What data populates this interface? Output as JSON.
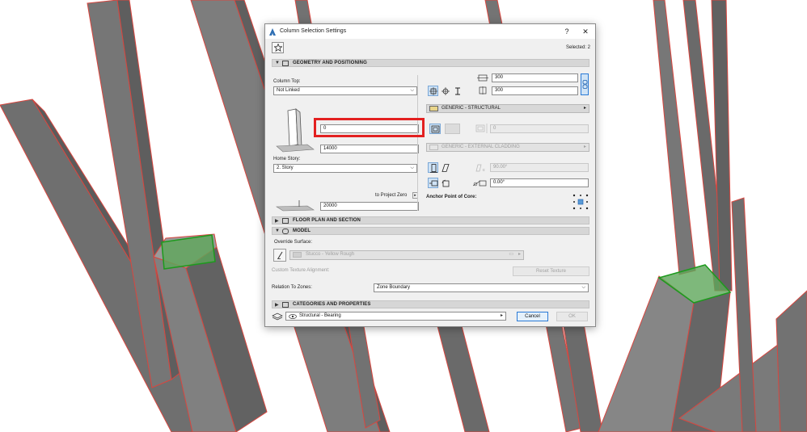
{
  "dialog": {
    "title": "Column Selection Settings",
    "help_label": "?",
    "close_label": "✕",
    "selected_text": "Selected: 2",
    "accent_color": "#e32020"
  },
  "geometry": {
    "section_title": "GEOMETRY AND POSITIONING",
    "column_top_label": "Column Top:",
    "column_top_value": "Not Linked",
    "top_offset_value": "0",
    "height_value": "14000",
    "home_story_label": "Home Story:",
    "home_story_value": "2. Story",
    "reference_label": "to Project Zero",
    "elevation_value": "20000",
    "width_value": "300",
    "depth_value": "300",
    "core_material": "GENERIC - STRUCTURAL",
    "veneer_thickness": "0",
    "veneer_material": "GENERIC - EXTERNAL CLADDING",
    "slant_angle": "90.00°",
    "rotation_angle": "0.00°",
    "anchor_label": "Anchor Point of Core:"
  },
  "floor_plan": {
    "section_title": "FLOOR PLAN AND SECTION"
  },
  "model": {
    "section_title": "MODEL",
    "override_label": "Override Surface:",
    "surface_value": "Stucco - Yellow Rough",
    "texture_alignment_label": "Custom Texture Alignment:",
    "reset_texture_label": "Reset Texture",
    "zones_label": "Relation To Zones:",
    "zones_value": "Zone Boundary"
  },
  "categories": {
    "section_title": "CATEGORIES AND PROPERTIES"
  },
  "footer": {
    "layer_value": "Structural - Bearing",
    "cancel_label": "Cancel",
    "ok_label": "OK"
  },
  "icons": [
    "favorites-icon",
    "gear-icon",
    "chain-link-icon",
    "column-preview-icon",
    "anchor-grid-icon",
    "layer-icon",
    "eye-icon"
  ]
}
